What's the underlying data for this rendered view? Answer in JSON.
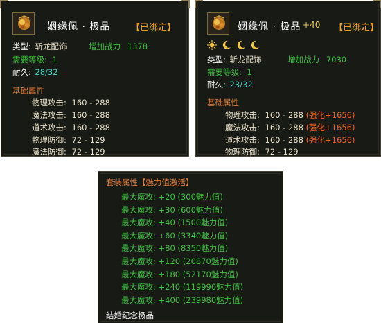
{
  "left_card": {
    "name": "姻缘佩 · 极品",
    "bound": "【已绑定】",
    "type_label": "类型:",
    "type_value": "斩龙配饰",
    "power_label": "增加战力",
    "power_value": "1378",
    "level_label": "需要等级:",
    "level_value": "1",
    "durability_label": "耐久:",
    "durability_value": "28/32",
    "section_title": "基础属性",
    "stats": [
      {
        "label": "物理攻击:",
        "value": "160 - 288"
      },
      {
        "label": "魔法攻击:",
        "value": "160 - 288"
      },
      {
        "label": "道术攻击:",
        "value": "160 - 288"
      },
      {
        "label": "物理防御:",
        "value": "72 - 129"
      },
      {
        "label": "魔法防御:",
        "value": "72 - 129"
      }
    ]
  },
  "right_card": {
    "name": "姻缘佩 · 极品",
    "plus": "+40",
    "bound": "【已绑定】",
    "star_icons": [
      "sun-icon",
      "moon-icon",
      "moon-icon",
      "moon-icon"
    ],
    "type_label": "类型:",
    "type_value": "斩龙配饰",
    "power_label": "增加战力",
    "power_value": "7030",
    "level_label": "需要等级:",
    "level_value": "1",
    "durability_label": "耐久:",
    "durability_value": "23/32",
    "section_title": "基础属性",
    "stats": [
      {
        "label": "物理攻击:",
        "value": "160 - 288",
        "enhance": "(强化+1656)"
      },
      {
        "label": "魔法攻击:",
        "value": "160 - 288",
        "enhance": "(强化+1656)"
      },
      {
        "label": "道术攻击:",
        "value": "160 - 288",
        "enhance": "(强化+1656)"
      },
      {
        "label": "物理防御:",
        "value": "72 - 129",
        "enhance": ""
      }
    ]
  },
  "set_card": {
    "title": "套装属性【魅力值激活】",
    "bonuses": [
      "最大魔攻: +20 (300魅力值)",
      "最大魔攻: +30 (600魅力值)",
      "最大魔攻: +40 (1500魅力值)",
      "最大魔攻: +60 (3340魅力值)",
      "最大魔攻: +80 (8350魅力值)",
      "最大魔攻: +120 (20870魅力值)",
      "最大魔攻: +180 (52170魅力值)",
      "最大魔攻: +240 (119990魅力值)",
      "最大魔攻: +400 (239980魅力值)"
    ],
    "footer": "结婚纪念极品"
  },
  "colors": {
    "panel_bg": "#181a16",
    "name": "#ffffff",
    "bound": "#f0a020",
    "power": "#40c040",
    "durability": "#40d0c0",
    "section": "#e08040",
    "enhance": "#f06020",
    "set_bonus": "#40c040"
  }
}
